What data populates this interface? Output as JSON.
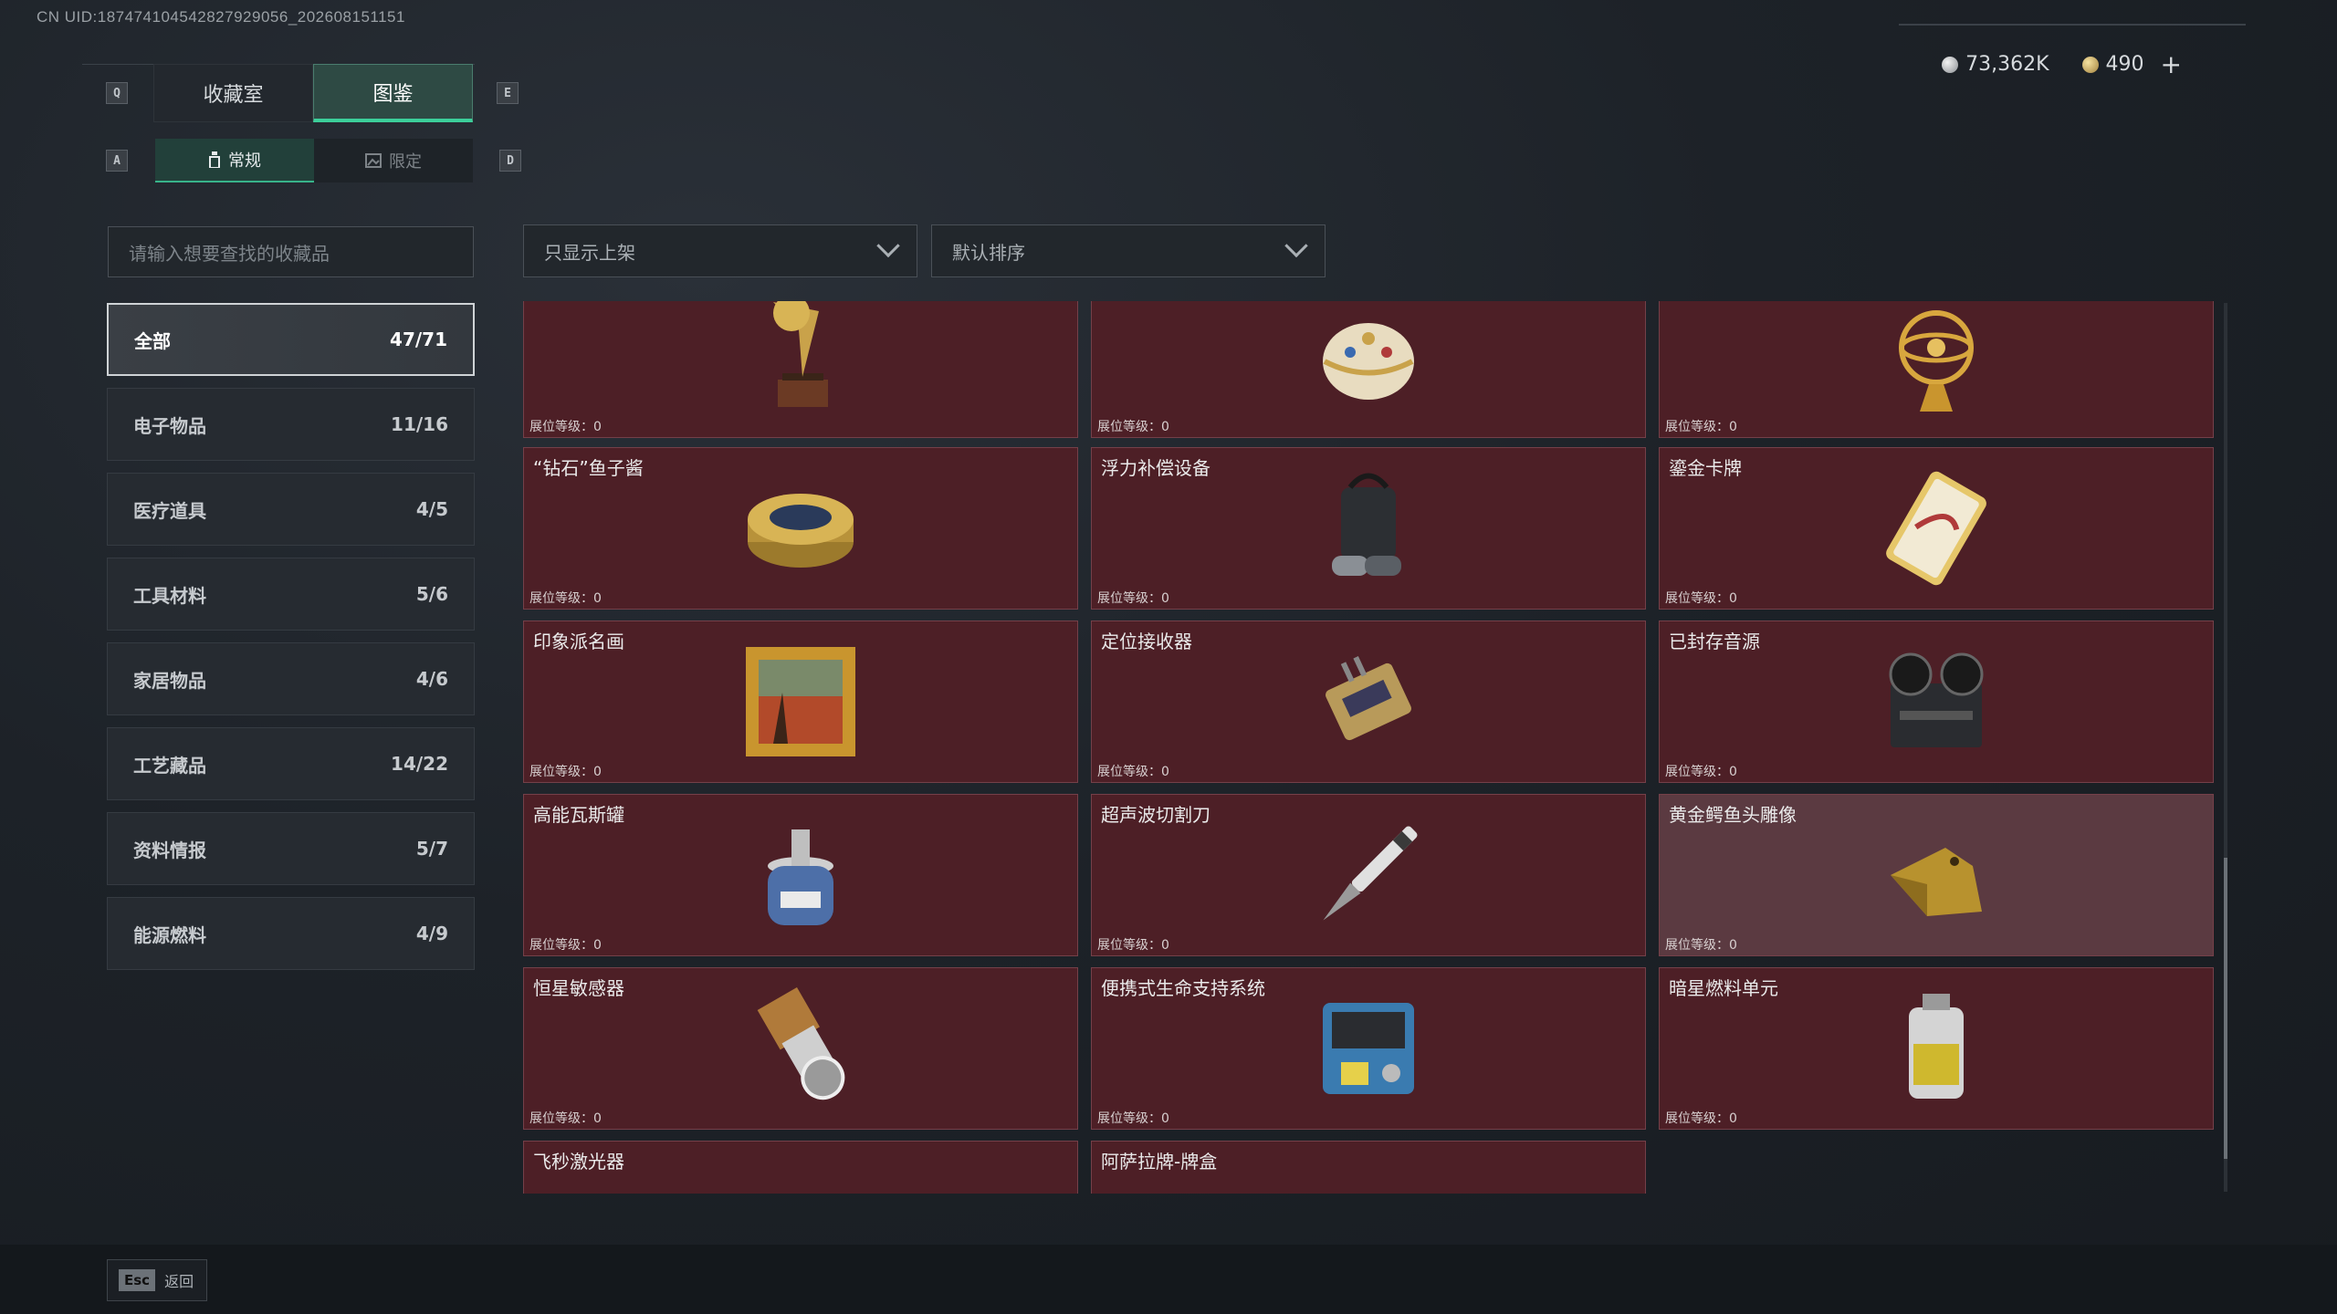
{
  "uid": "CN UID:187474104542827929056_202608151151",
  "currency": {
    "silver_value": "73,362K",
    "gold_value": "490",
    "add_symbol": "+"
  },
  "keys": {
    "prev_tab": "Q",
    "next_tab": "E",
    "prev_sub": "A",
    "next_sub": "D"
  },
  "tabs": [
    {
      "label": "收藏室",
      "active": false
    },
    {
      "label": "图鉴",
      "active": true
    }
  ],
  "subtabs": [
    {
      "label": "常规",
      "active": true
    },
    {
      "label": "限定",
      "active": false
    }
  ],
  "search": {
    "placeholder": "请输入想要查找的收藏品"
  },
  "filters": {
    "display_filter": "只显示上架",
    "sort": "默认排序"
  },
  "categories": [
    {
      "label": "全部",
      "count": "47/71",
      "active": true
    },
    {
      "label": "电子物品",
      "count": "11/16"
    },
    {
      "label": "医疗道具",
      "count": "4/5"
    },
    {
      "label": "工具材料",
      "count": "5/6"
    },
    {
      "label": "家居物品",
      "count": "4/6"
    },
    {
      "label": "工艺藏品",
      "count": "14/22"
    },
    {
      "label": "资料情报",
      "count": "5/7"
    },
    {
      "label": "能源燃料",
      "count": "4/9"
    }
  ],
  "level_label": "展位等级：0",
  "items": [
    {
      "name": "",
      "icon": "gramophone-icon"
    },
    {
      "name": "",
      "icon": "jeweled-egg-icon"
    },
    {
      "name": "",
      "icon": "armillary-sphere-icon"
    },
    {
      "name": "“钻石”鱼子酱",
      "icon": "caviar-tin-icon"
    },
    {
      "name": "浮力补偿设备",
      "icon": "buoyancy-device-icon"
    },
    {
      "name": "鎏金卡牌",
      "icon": "gilded-card-icon"
    },
    {
      "name": "印象派名画",
      "icon": "framed-painting-icon"
    },
    {
      "name": "定位接收器",
      "icon": "locator-receiver-icon"
    },
    {
      "name": "已封存音源",
      "icon": "reel-recorder-icon"
    },
    {
      "name": "高能瓦斯罐",
      "icon": "gas-canister-icon"
    },
    {
      "name": "超声波切割刀",
      "icon": "ultrasonic-cutter-icon"
    },
    {
      "name": "黄金鳄鱼头雕像",
      "icon": "gold-crocodile-head-icon"
    },
    {
      "name": "恒星敏感器",
      "icon": "star-sensor-icon"
    },
    {
      "name": "便携式生命支持系统",
      "icon": "life-support-icon"
    },
    {
      "name": "暗星燃料单元",
      "icon": "fuel-cell-icon"
    },
    {
      "name": "飞秒激光器",
      "icon": "laser-device-icon"
    },
    {
      "name": "阿萨拉牌-牌盒",
      "icon": "card-box-icon"
    }
  ],
  "footer": {
    "esc_key": "Esc",
    "back_label": "返回"
  }
}
